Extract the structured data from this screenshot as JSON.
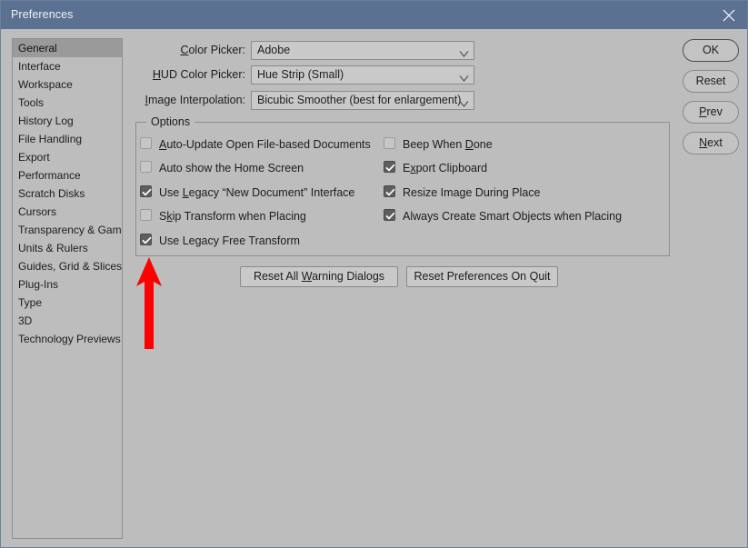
{
  "window": {
    "title": "Preferences",
    "close_icon": "close-icon"
  },
  "sidebar": {
    "items": [
      {
        "label": "General",
        "selected": true
      },
      {
        "label": "Interface",
        "selected": false
      },
      {
        "label": "Workspace",
        "selected": false
      },
      {
        "label": "Tools",
        "selected": false
      },
      {
        "label": "History Log",
        "selected": false
      },
      {
        "label": "File Handling",
        "selected": false
      },
      {
        "label": "Export",
        "selected": false
      },
      {
        "label": "Performance",
        "selected": false
      },
      {
        "label": "Scratch Disks",
        "selected": false
      },
      {
        "label": "Cursors",
        "selected": false
      },
      {
        "label": "Transparency & Gamut",
        "selected": false
      },
      {
        "label": "Units & Rulers",
        "selected": false
      },
      {
        "label": "Guides, Grid & Slices",
        "selected": false
      },
      {
        "label": "Plug-Ins",
        "selected": false
      },
      {
        "label": "Type",
        "selected": false
      },
      {
        "label": "3D",
        "selected": false
      },
      {
        "label": "Technology Previews",
        "selected": false
      }
    ]
  },
  "fields": [
    {
      "label_pre": "",
      "label_key": "C",
      "label_post": "olor Picker:",
      "value": "Adobe"
    },
    {
      "label_pre": "",
      "label_key": "H",
      "label_post": "UD Color Picker:",
      "value": "Hue Strip (Small)"
    },
    {
      "label_pre": "",
      "label_key": "I",
      "label_post": "mage Interpolation:",
      "value": "Bicubic Smoother (best for enlargement)"
    }
  ],
  "options": {
    "legend": "Options",
    "left_column": [
      {
        "pre": "",
        "key": "A",
        "post": "uto-Update Open File-based Documents",
        "checked": false
      },
      {
        "pre": "Auto show the Home Screen",
        "key": "",
        "post": "",
        "checked": false
      },
      {
        "pre": "Use ",
        "key": "L",
        "post": "egacy “New Document” Interface",
        "checked": true
      },
      {
        "pre": "S",
        "key": "k",
        "post": "ip Transform when Placing",
        "checked": false
      },
      {
        "pre": "Use Legacy Free Transform",
        "key": "",
        "post": "",
        "checked": true
      }
    ],
    "right_column": [
      {
        "pre": "Beep When ",
        "key": "D",
        "post": "one",
        "checked": false
      },
      {
        "pre": "E",
        "key": "x",
        "post": "port Clipboard",
        "checked": true
      },
      {
        "pre": "Resize Ima",
        "key": "g",
        "post": "e During Place",
        "checked": true
      },
      {
        "pre": "Always Create Smart Ob",
        "key": "j",
        "post": "ects when Placing",
        "checked": true
      }
    ]
  },
  "reset_buttons": [
    {
      "pre": "Reset All ",
      "key": "W",
      "post": "arning Dialogs"
    },
    {
      "pre": "Reset Preferences On Quit",
      "key": "",
      "post": ""
    }
  ],
  "action_buttons": [
    {
      "pre": "OK",
      "key": "",
      "post": "",
      "default": true
    },
    {
      "pre": "Reset",
      "key": "",
      "post": "",
      "default": false
    },
    {
      "pre": "",
      "key": "P",
      "post": "rev",
      "default": false
    },
    {
      "pre": "",
      "key": "N",
      "post": "ext",
      "default": false
    }
  ],
  "annotation": {
    "type": "arrow",
    "direction": "up",
    "color": "#fe0000",
    "points_at": "Use Legacy Free Transform"
  }
}
